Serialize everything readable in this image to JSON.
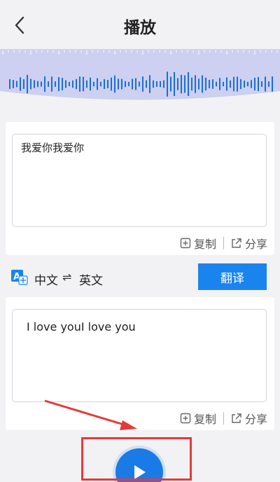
{
  "header": {
    "title": "播放",
    "back_icon": "chevron-left-icon"
  },
  "source": {
    "text": "我爱你我爱你",
    "copy_label": "复制",
    "share_label": "分享"
  },
  "language_bar": {
    "from": "中文",
    "swap_symbol": "⇌",
    "to": "英文",
    "translate_label": "翻译"
  },
  "result": {
    "text": "I love youI love you",
    "copy_label": "复制",
    "share_label": "分享"
  },
  "colors": {
    "accent": "#1a84ee",
    "wave": "#1a6fd6",
    "wave_bg": "#cdd0f0",
    "annotation": "#e53a3a"
  }
}
